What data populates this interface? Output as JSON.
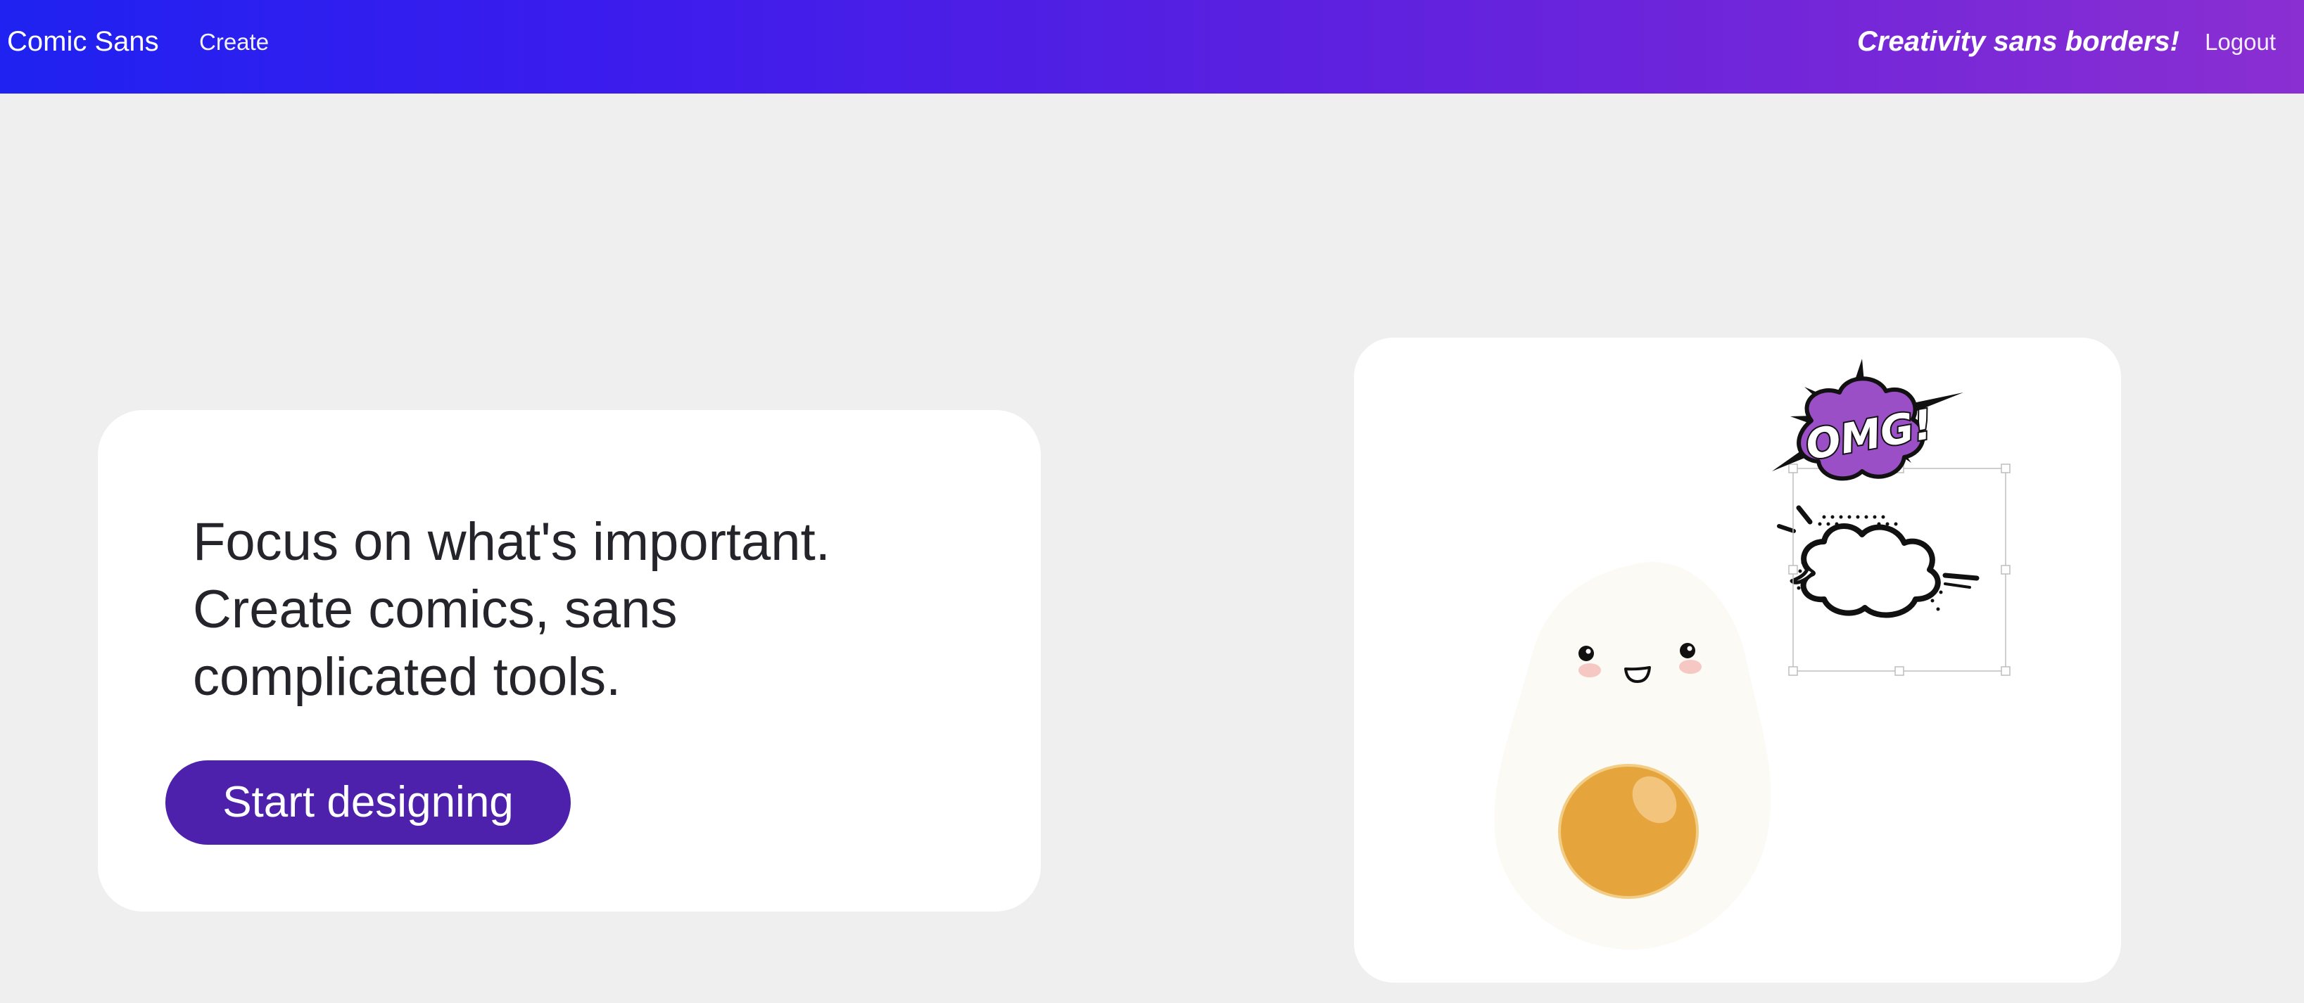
{
  "navbar": {
    "brand": "Comic Sans",
    "create_label": "Create",
    "tagline": "Creativity sans borders!",
    "logout_label": "Logout",
    "gradient_start": "#1f22f0",
    "gradient_end": "#8a2fd2"
  },
  "hero": {
    "lines": [
      "Focus on what's important.",
      "Create comics, sans",
      "complicated tools."
    ],
    "cta_label": "Start designing",
    "cta_color": "#4e21ac"
  },
  "preview": {
    "omg_text": "OMG!",
    "omg_color": "#9b4fc7",
    "egg_white_color": "#fbfaf4",
    "yolk_color": "#e6a43c",
    "icons": [
      "egg-character-icon",
      "omg-burst-icon",
      "speech-bubble-icon"
    ]
  }
}
